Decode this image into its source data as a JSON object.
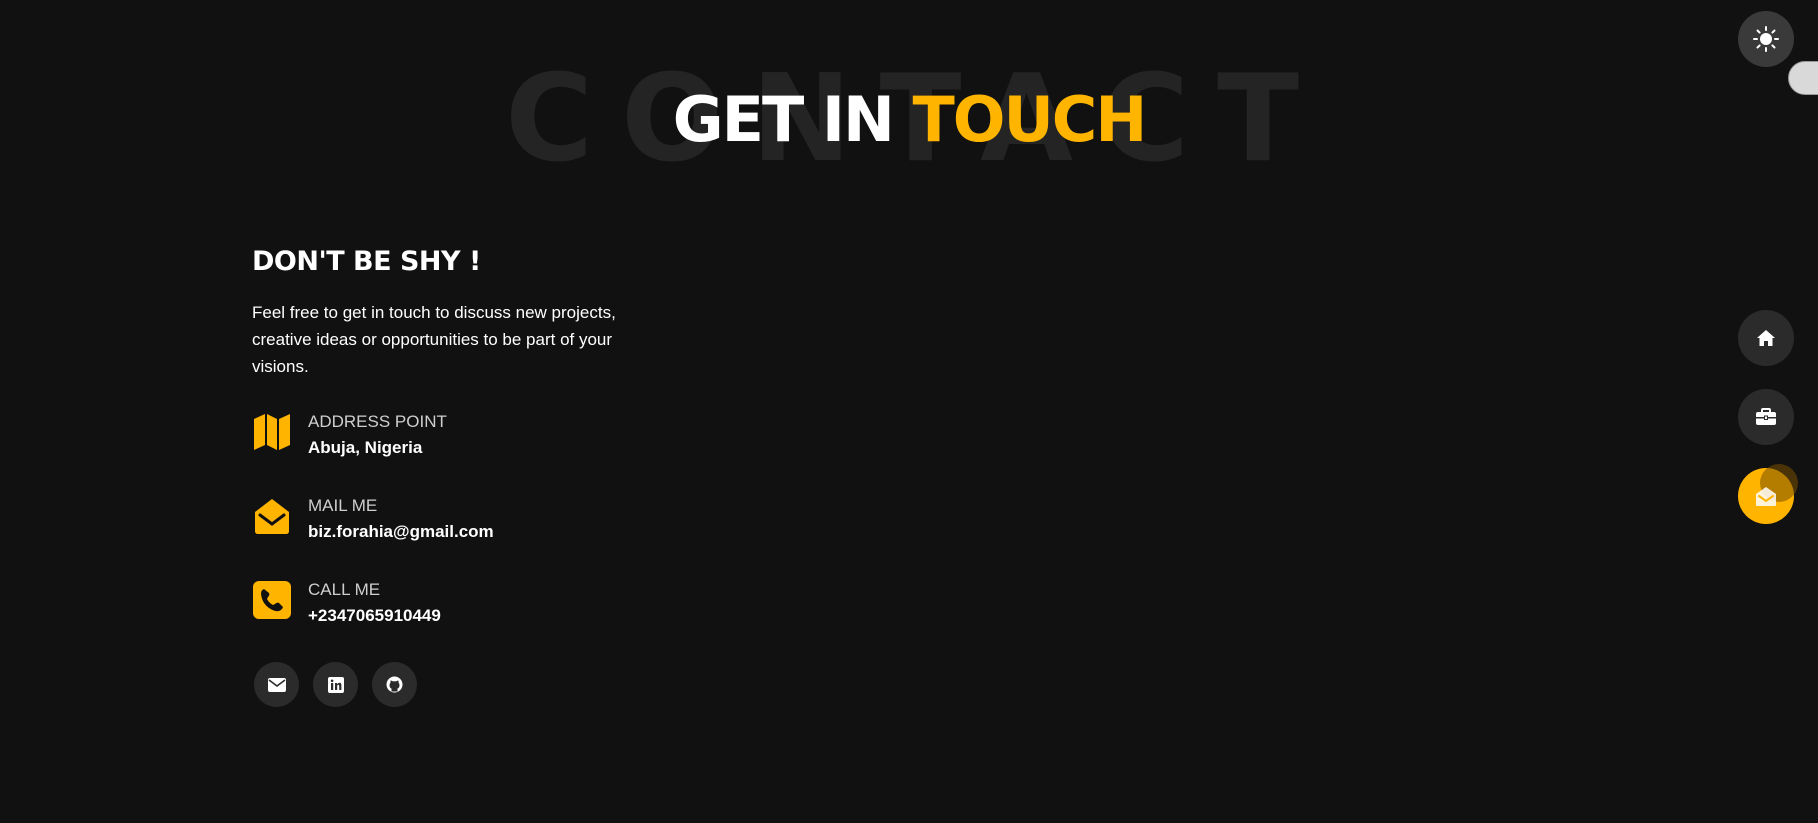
{
  "title": {
    "background_text": "CONTACT",
    "main_text": "GET IN",
    "accent_text": "TOUCH"
  },
  "info": {
    "heading": "DON'T BE SHY !",
    "lead": "Feel free to get in touch to discuss new projects, creative ideas or opportunities to be part of your visions.",
    "items": [
      {
        "label": "ADDRESS POINT",
        "value": "Abuja, Nigeria",
        "icon": "map-icon"
      },
      {
        "label": "MAIL ME",
        "value": "biz.forahia@gmail.com",
        "icon": "envelope-open-icon"
      },
      {
        "label": "CALL ME",
        "value": "+2347065910449",
        "icon": "phone-icon"
      }
    ]
  },
  "socials": [
    {
      "icon": "envelope-icon"
    },
    {
      "icon": "linkedin-icon"
    },
    {
      "icon": "github-icon"
    }
  ],
  "nav": [
    {
      "icon": "home-icon",
      "active": false
    },
    {
      "icon": "briefcase-icon",
      "active": false
    },
    {
      "icon": "envelope-open-icon",
      "active": true
    }
  ],
  "colors": {
    "background": "#111111",
    "accent": "#ffb400",
    "button": "#2b2b2b",
    "title_shadow": "#242424"
  }
}
